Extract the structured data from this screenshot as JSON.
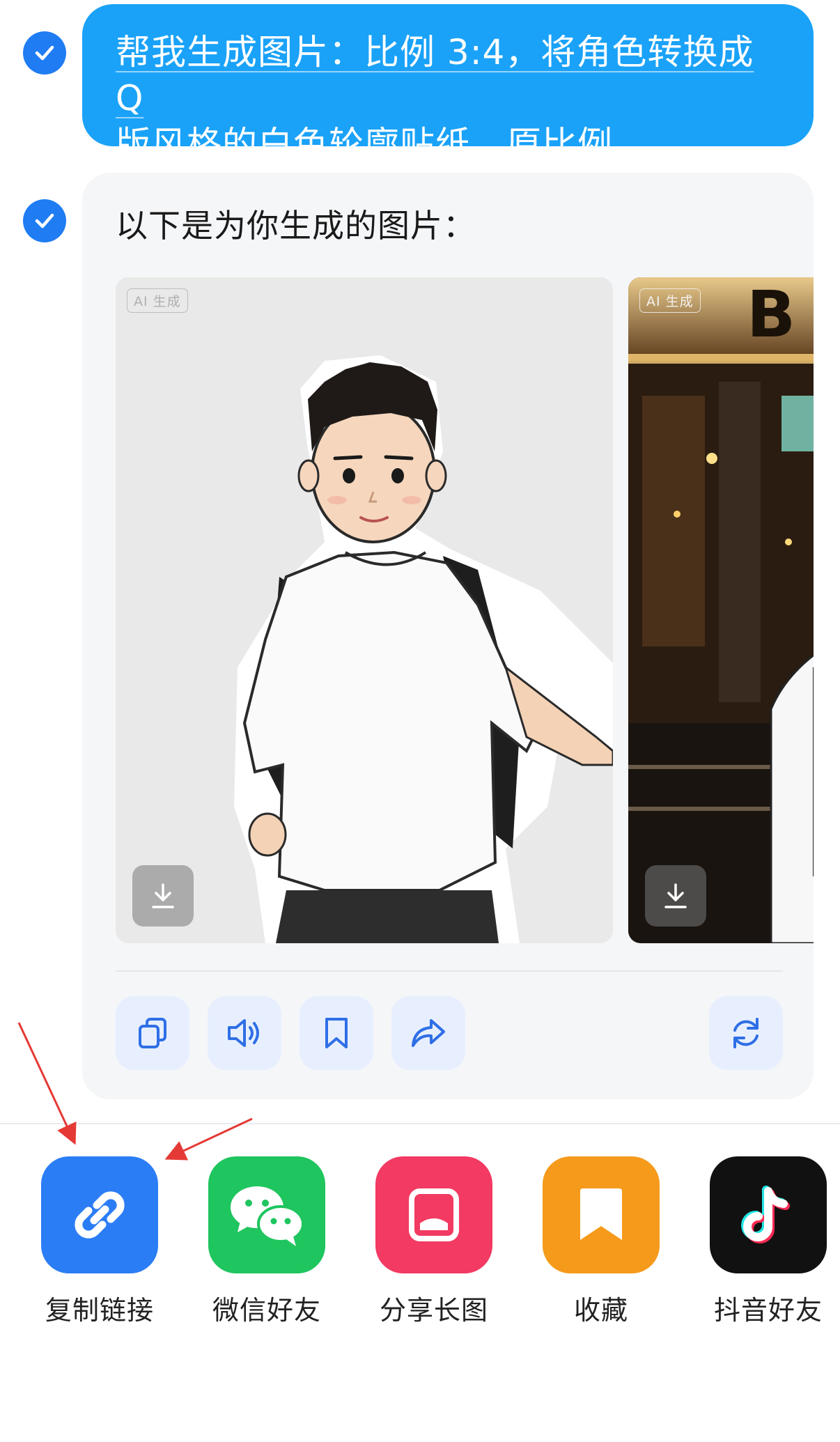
{
  "user_message": {
    "line1": "帮我生成图片：比例 3:4，将角色转换成 Q",
    "line2": "版风格的白色轮廓贴纸。原比例。"
  },
  "ai_response": {
    "intro": "以下是为你生成的图片：",
    "images": [
      {
        "tag": "AI 生成"
      },
      {
        "tag": "AI 生成"
      }
    ]
  },
  "share_sheet": {
    "items": [
      {
        "label": "复制链接",
        "icon": "link-icon",
        "color": "#2b7df5"
      },
      {
        "label": "微信好友",
        "icon": "wechat-icon",
        "color": "#1fc55e"
      },
      {
        "label": "分享长图",
        "icon": "image-icon",
        "color": "#f23a62"
      },
      {
        "label": "收藏",
        "icon": "bookmark-icon",
        "color": "#f59a1b"
      },
      {
        "label": "抖音好友",
        "icon": "douyin-icon",
        "color": "#111111"
      }
    ]
  },
  "colors": {
    "accent": "#1f7cf3",
    "user_bubble": "#1aa2f8",
    "annotation_arrow": "#e53935"
  }
}
